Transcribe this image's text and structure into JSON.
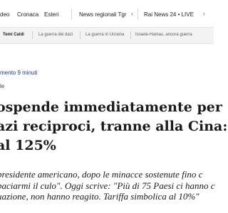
{
  "nav": {
    "items": [
      "deo",
      "Cronaca",
      "Esteri",
      "News regionali Tgr",
      "Rai News 24 • LIVE"
    ],
    "chevron": "›"
  },
  "subnav": {
    "items": [
      "Temi Caldi",
      "La guerra dei dazi",
      "La guerra in Ucraina",
      "Israele-Hamas, ancora guerra"
    ]
  },
  "article": {
    "reading_time": "mento 9 minuti",
    "category": "le",
    "headline_lines": [
      "ospende immediatamente per",
      "azi reciproci, tranne alla Cina:",
      "al 125%"
    ],
    "lead_lines": [
      "presidente americano, dopo le minacce sostenute fino c",
      "baciarmi il culo\". Oggi scrive: \"Più di 75 Paesi ci hanno c",
      "uazione, non hanno reagito. Tariffa simbolica al 10%\""
    ]
  },
  "colors": {
    "link": "#1b3a87",
    "subnav_bg": "#f3f3f3"
  }
}
